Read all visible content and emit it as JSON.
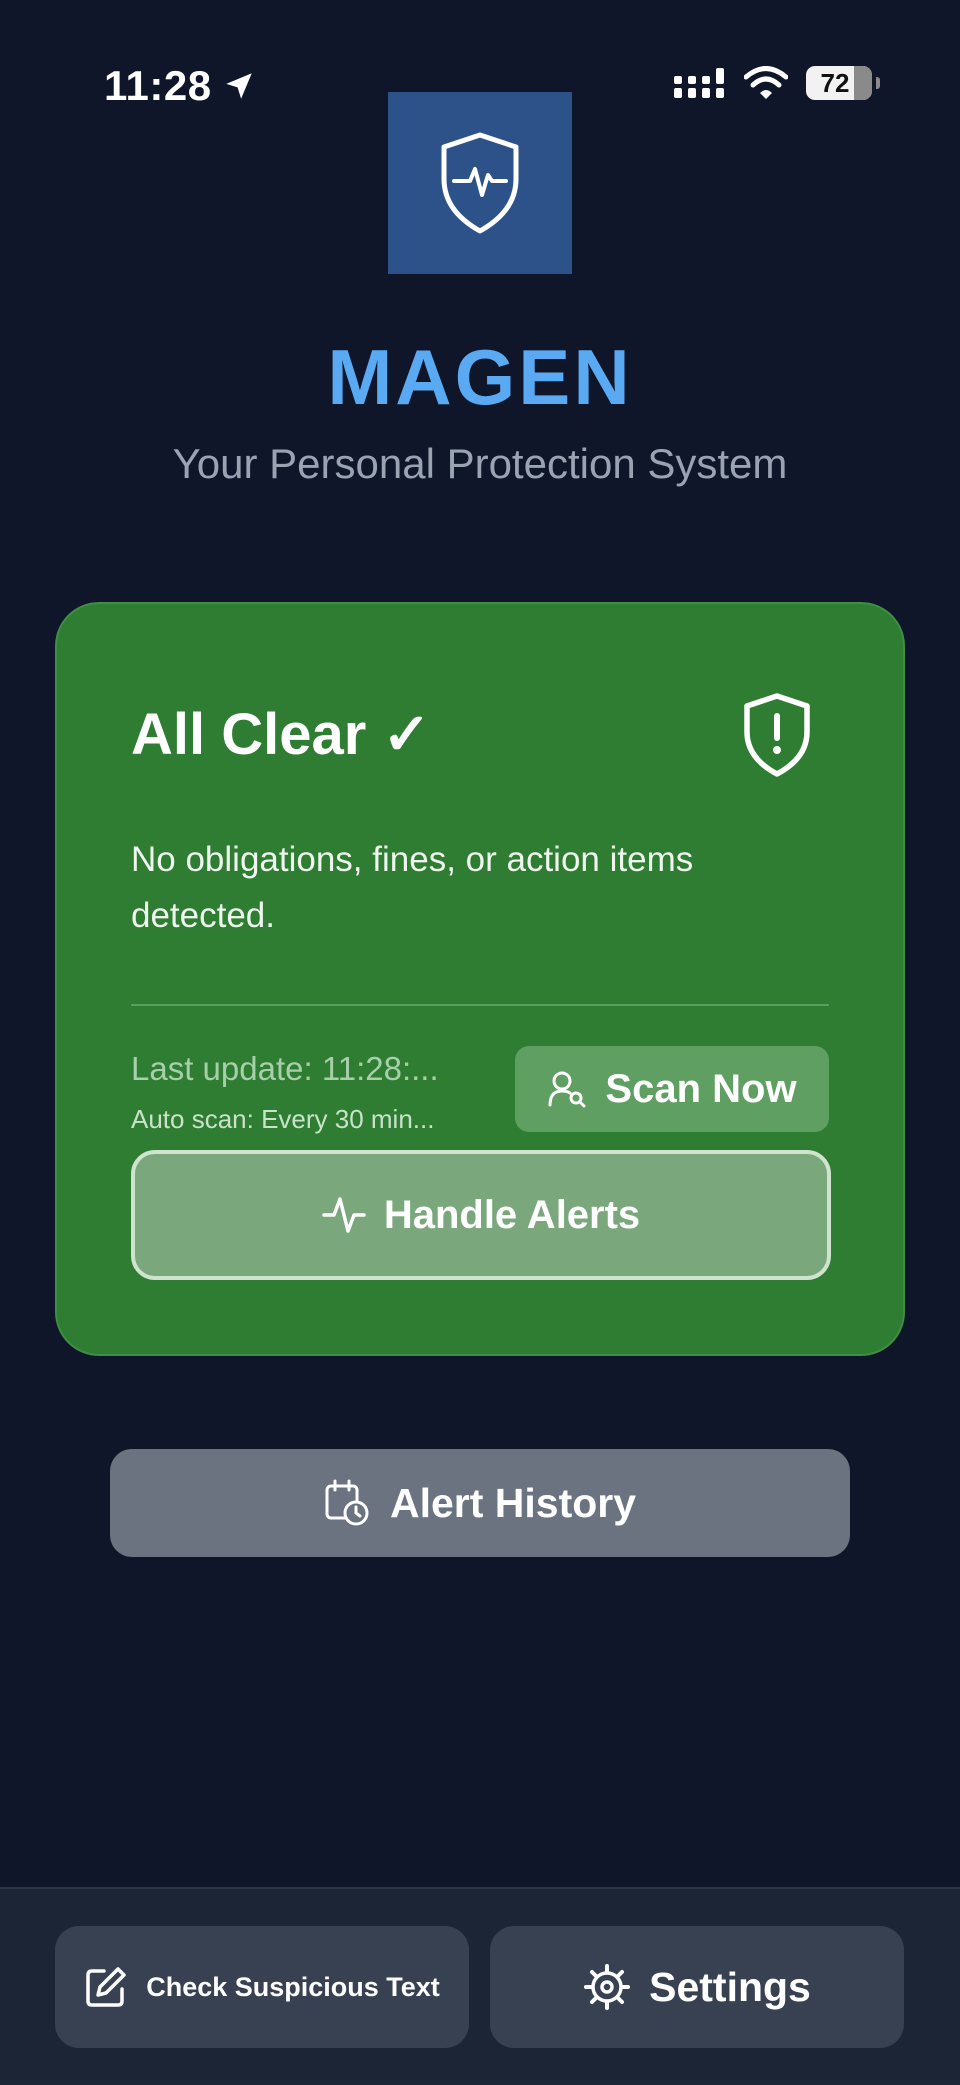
{
  "status_bar": {
    "time": "11:28",
    "battery": "72"
  },
  "header": {
    "title": "MAGEN",
    "subtitle": "Your Personal Protection System"
  },
  "status_card": {
    "title": "All Clear ✓",
    "message": "No obligations, fines, or action items detected.",
    "last_update": "Last update: 11:28:...",
    "auto_scan": "Auto scan: Every 30 min...",
    "scan_button": "Scan Now",
    "handle_button": "Handle Alerts",
    "color": "#2e7d32"
  },
  "history_button": "Alert History",
  "bottom_bar": {
    "check_label": "Check Suspicious Text",
    "settings_label": "Settings"
  },
  "icons": {
    "logo": "shield-heartbeat-icon",
    "card": "shield-alert-icon",
    "scan": "user-search-icon",
    "handle": "activity-icon",
    "history": "calendar-clock-icon",
    "check": "edit-icon",
    "settings": "gear-icon"
  },
  "colors": {
    "background": "#0f1629",
    "accent": "#5aa9f3",
    "logo_bg": "#2c5289"
  }
}
